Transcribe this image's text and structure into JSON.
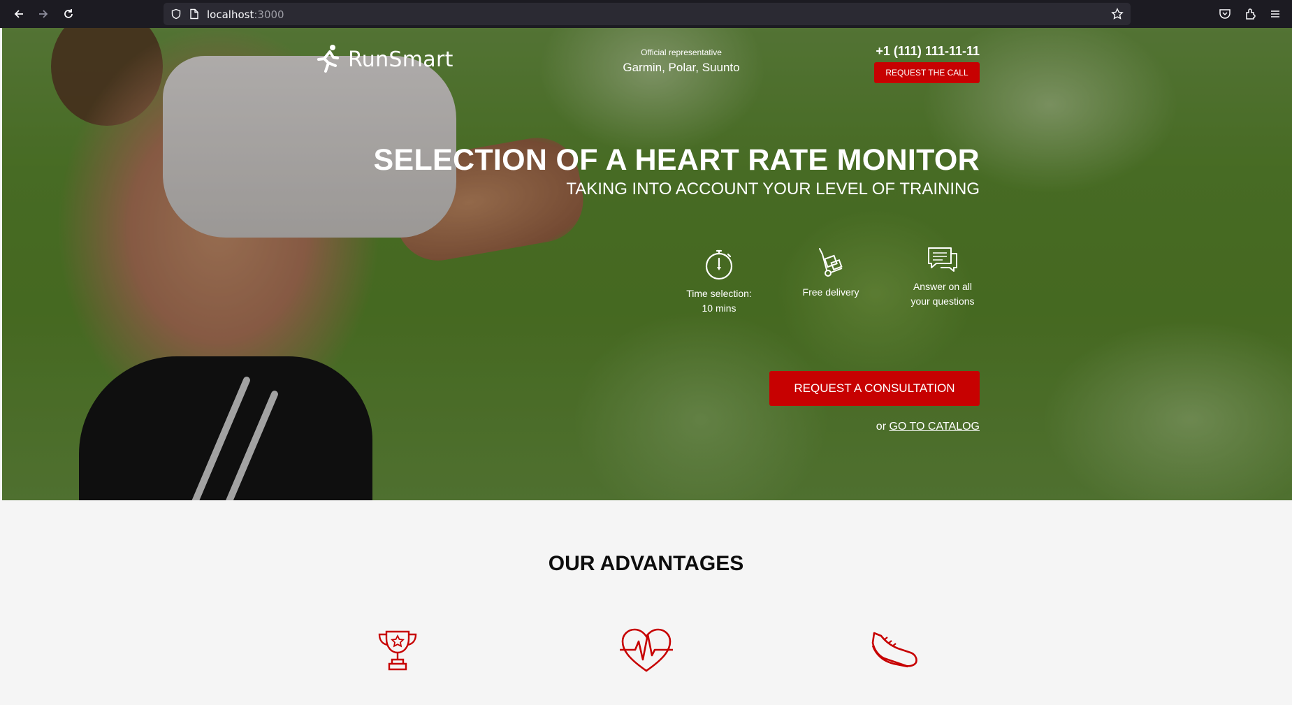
{
  "browser": {
    "url_host": "localhost",
    "url_port": ":3000"
  },
  "header": {
    "logo_text": "RunSmart",
    "rep_label": "Official representative",
    "rep_brands": "Garmin, Polar, Suunto",
    "phone": "+1 (111) 111-11-11",
    "call_button": "REQUEST THE CALL"
  },
  "hero": {
    "title": "SELECTION OF A HEART RATE MONITOR",
    "subtitle": "TAKING INTO ACCOUNT YOUR LEVEL OF TRAINING",
    "features": [
      {
        "icon": "stopwatch-icon",
        "line1": "Time selection:",
        "line2": "10 mins"
      },
      {
        "icon": "delivery-cart-icon",
        "line1": "Free delivery",
        "line2": ""
      },
      {
        "icon": "chat-bubbles-icon",
        "line1": "Answer on all",
        "line2": "your questions"
      }
    ],
    "consult_button": "REQUEST A CONSULTATION",
    "catalog_prefix": "or",
    "catalog_link": "GO TO CATALOG"
  },
  "advantages": {
    "title": "OUR ADVANTAGES",
    "icons": [
      "trophy-icon",
      "heart-pulse-icon",
      "running-shoe-icon"
    ]
  },
  "colors": {
    "accent": "#c70101",
    "chrome": "#1c1b22",
    "section_bg": "#f5f5f5"
  }
}
